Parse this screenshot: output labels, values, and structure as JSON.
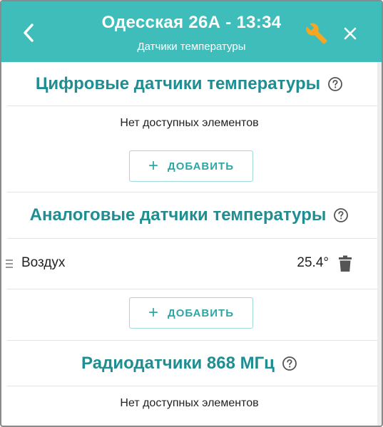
{
  "header": {
    "title": "Одесская 26А  - 13:34",
    "subtitle": "Датчики температуры",
    "background_color": "#3fbdbb",
    "wrench_color": "#f5a623",
    "icons": {
      "back": "chevron-left-icon",
      "settings": "wrench-icon",
      "close": "close-icon"
    }
  },
  "sections": {
    "digital": {
      "title": "Цифровые датчики температуры",
      "empty_text": "Нет доступных элементов",
      "add_label": "ДОБАВИТЬ"
    },
    "analog": {
      "title": "Аналоговые датчики температуры",
      "sensors": [
        {
          "name": "Воздух",
          "value": "25.4°"
        }
      ],
      "add_label": "ДОБАВИТЬ"
    },
    "radio": {
      "title": "Радиодатчики 868 МГц",
      "empty_text": "Нет доступных элементов"
    }
  },
  "accent_color": "#1f8e92"
}
